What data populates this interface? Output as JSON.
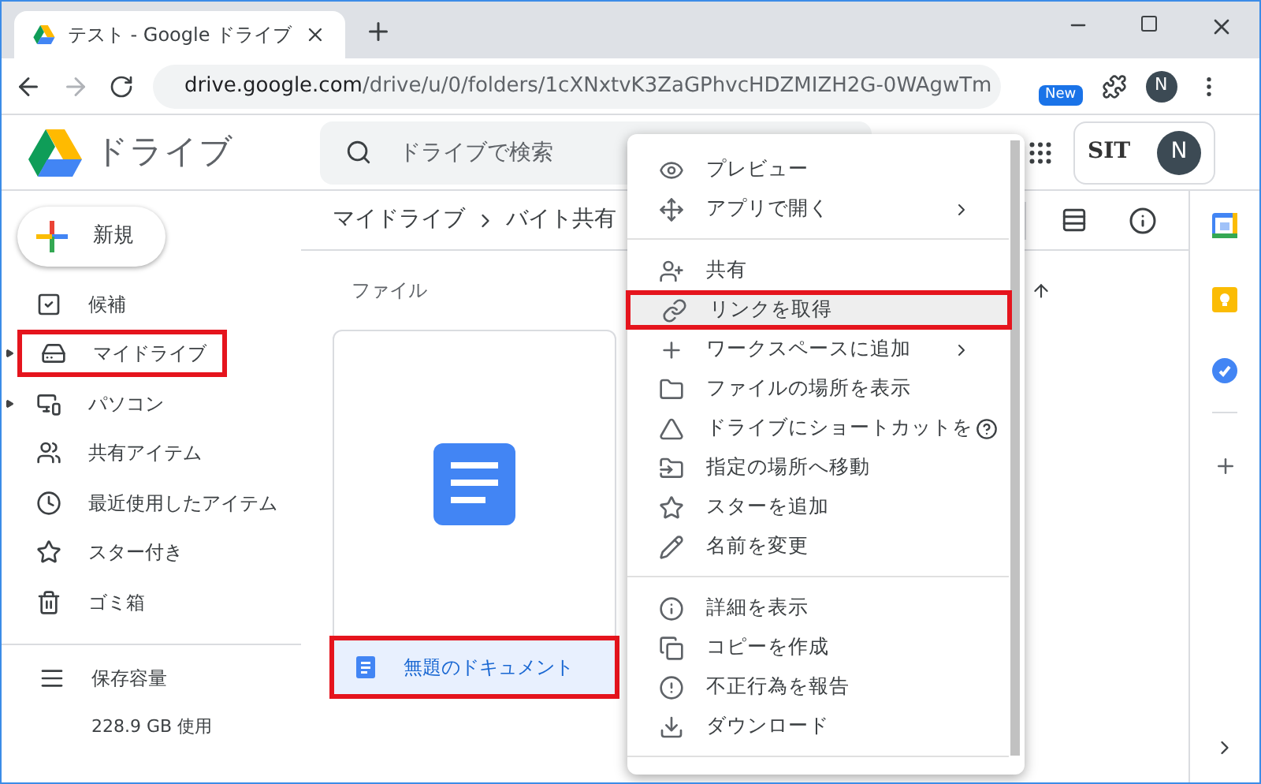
{
  "browser": {
    "tab_title": "テスト - Google ドライブ",
    "url_host": "drive.google.com",
    "url_path": "/drive/u/0/folders/1cXNxtvK3ZaGPhvcHDZMIZH2G-0WAgwTm",
    "extension_badge": "New",
    "profile_initial": "N"
  },
  "header": {
    "app_name": "ドライブ",
    "search": {
      "placeholder": "ドライブで検索"
    },
    "org_logo": "SIT",
    "account_initial": "N"
  },
  "sidebar": {
    "new_button": "新規",
    "items": [
      {
        "label": "候補",
        "expandable": false,
        "highlighted": false
      },
      {
        "label": "マイドライブ",
        "expandable": true,
        "highlighted": true
      },
      {
        "label": "パソコン",
        "expandable": true,
        "highlighted": false
      },
      {
        "label": "共有アイテム",
        "expandable": false,
        "highlighted": false
      },
      {
        "label": "最近使用したアイテム",
        "expandable": false,
        "highlighted": false
      },
      {
        "label": "スター付き",
        "expandable": false,
        "highlighted": false
      },
      {
        "label": "ゴミ箱",
        "expandable": false,
        "highlighted": false
      }
    ],
    "storage": {
      "label": "保存容量",
      "usage": "228.9 GB 使用"
    }
  },
  "main": {
    "breadcrumb": [
      "マイドライブ",
      "バイト共有"
    ],
    "section_label": "ファイル",
    "files": [
      {
        "name": "無題のドキュメント",
        "highlighted": true
      }
    ]
  },
  "context_menu": {
    "sections": [
      [
        {
          "label": "プレビュー",
          "submenu": false,
          "selected": false,
          "highlighted": false,
          "help_overlay": false
        },
        {
          "label": "アプリで開く",
          "submenu": true,
          "selected": false,
          "highlighted": false,
          "help_overlay": false
        }
      ],
      [
        {
          "label": "共有",
          "submenu": false,
          "selected": false,
          "highlighted": false,
          "help_overlay": false
        },
        {
          "label": "リンクを取得",
          "submenu": false,
          "selected": true,
          "highlighted": true,
          "help_overlay": false
        },
        {
          "label": "ワークスペースに追加",
          "submenu": true,
          "selected": false,
          "highlighted": false,
          "help_overlay": false
        },
        {
          "label": "ファイルの場所を表示",
          "submenu": false,
          "selected": false,
          "highlighted": false,
          "help_overlay": false
        },
        {
          "label": "ドライブにショートカットを",
          "submenu": false,
          "selected": false,
          "highlighted": false,
          "help_overlay": true
        },
        {
          "label": "指定の場所へ移動",
          "submenu": false,
          "selected": false,
          "highlighted": false,
          "help_overlay": false
        },
        {
          "label": "スターを追加",
          "submenu": false,
          "selected": false,
          "highlighted": false,
          "help_overlay": false
        },
        {
          "label": "名前を変更",
          "submenu": false,
          "selected": false,
          "highlighted": false,
          "help_overlay": false
        }
      ],
      [
        {
          "label": "詳細を表示",
          "submenu": false,
          "selected": false,
          "highlighted": false,
          "help_overlay": false
        },
        {
          "label": "コピーを作成",
          "submenu": false,
          "selected": false,
          "highlighted": false,
          "help_overlay": false
        },
        {
          "label": "不正行為を報告",
          "submenu": false,
          "selected": false,
          "highlighted": false,
          "help_overlay": false
        },
        {
          "label": "ダウンロード",
          "submenu": false,
          "selected": false,
          "highlighted": false,
          "help_overlay": false
        }
      ]
    ]
  }
}
